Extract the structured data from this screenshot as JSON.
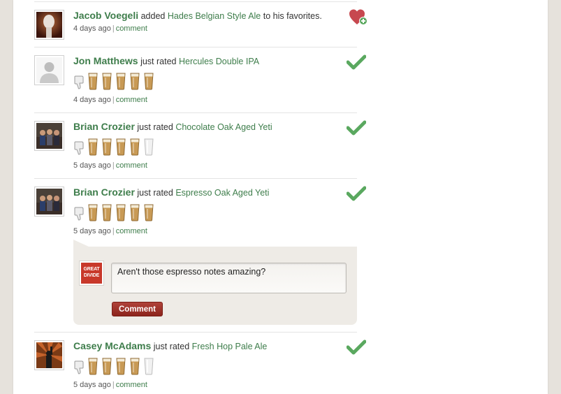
{
  "feed": {
    "items": [
      {
        "user": "Jacob Voegeli",
        "action": "added",
        "beer": "Hades Belgian Style Ale",
        "suffix": "to his favorites.",
        "time": "4 days ago",
        "separator": "|",
        "comment_label": "comment",
        "badge_icon": "heart-plus-icon"
      },
      {
        "user": "Jon Matthews",
        "action": "just rated",
        "beer": "Hercules Double IPA",
        "rating": 5,
        "rating_max": 5,
        "time": "4 days ago",
        "separator": "|",
        "comment_label": "comment",
        "badge_icon": "checkmark-icon"
      },
      {
        "user": "Brian Crozier",
        "action": "just rated",
        "beer": "Chocolate Oak Aged Yeti",
        "rating": 4,
        "rating_max": 5,
        "time": "5 days ago",
        "separator": "|",
        "comment_label": "comment",
        "badge_icon": "checkmark-icon"
      },
      {
        "user": "Brian Crozier",
        "action": "just rated",
        "beer": "Espresso Oak Aged Yeti",
        "rating": 5,
        "rating_max": 5,
        "time": "5 days ago",
        "separator": "|",
        "comment_label": "comment",
        "badge_icon": "checkmark-icon"
      },
      {
        "user": "Casey McAdams",
        "action": "just rated",
        "beer": "Fresh Hop Pale Ale",
        "rating": 4,
        "rating_max": 5,
        "time": "5 days ago",
        "separator": "|",
        "comment_label": "comment",
        "badge_icon": "checkmark-icon"
      }
    ]
  },
  "comment_form": {
    "avatar_text_line1": "GREAT",
    "avatar_text_line2": "DIVIDE",
    "input_value": "Aren't those espresso notes amazing?",
    "button_label": "Comment"
  },
  "colors": {
    "link_green": "#3e7d4b",
    "check_green": "#5aa85f",
    "button_red": "#9e3028",
    "beer_amber": "#c89a55",
    "page_bg": "#e6e2dc"
  }
}
